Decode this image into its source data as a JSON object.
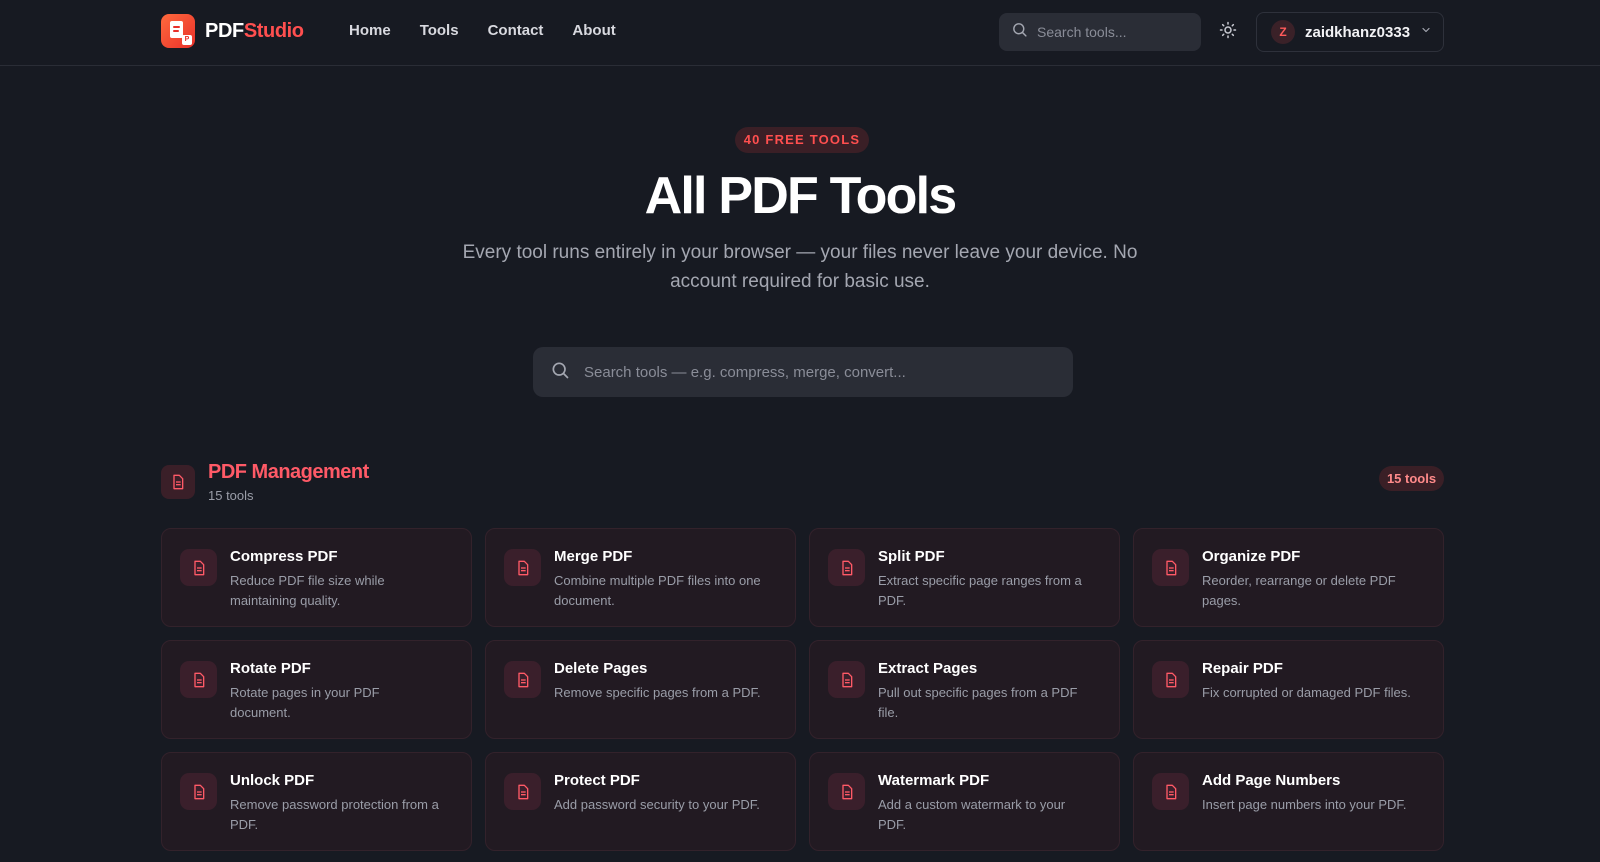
{
  "brand": {
    "name_part1": "PDF",
    "name_part2": "Studio",
    "accent": "#ff4f4f"
  },
  "nav": {
    "items": [
      {
        "label": "Home"
      },
      {
        "label": "Tools"
      },
      {
        "label": "Contact"
      },
      {
        "label": "About"
      }
    ]
  },
  "header_search": {
    "placeholder": "Search tools..."
  },
  "theme_toggle": {
    "icon": "sun-icon"
  },
  "user": {
    "avatar_letter": "Z",
    "name": "zaidkhanz0333",
    "icon": "chevron-down-icon"
  },
  "hero": {
    "badge": "40 FREE TOOLS",
    "title": "All PDF Tools",
    "subtitle": "Every tool runs entirely in your browser — your files never leave your device. No account required for basic use.",
    "search_placeholder": "Search tools — e.g. compress, merge, convert..."
  },
  "section": {
    "title": "PDF Management",
    "count": "15 tools",
    "pill": "15 tools",
    "icon": "document-icon",
    "tools": [
      {
        "title": "Compress PDF",
        "desc": "Reduce PDF file size while maintaining quality."
      },
      {
        "title": "Merge PDF",
        "desc": "Combine multiple PDF files into one document."
      },
      {
        "title": "Split PDF",
        "desc": "Extract specific page ranges from a PDF."
      },
      {
        "title": "Organize PDF",
        "desc": "Reorder, rearrange or delete PDF pages."
      },
      {
        "title": "Rotate PDF",
        "desc": "Rotate pages in your PDF document."
      },
      {
        "title": "Delete Pages",
        "desc": "Remove specific pages from a PDF."
      },
      {
        "title": "Extract Pages",
        "desc": "Pull out specific pages from a PDF file."
      },
      {
        "title": "Repair PDF",
        "desc": "Fix corrupted or damaged PDF files."
      },
      {
        "title": "Unlock PDF",
        "desc": "Remove password protection from a PDF."
      },
      {
        "title": "Protect PDF",
        "desc": "Add password security to your PDF."
      },
      {
        "title": "Watermark PDF",
        "desc": "Add a custom watermark to your PDF."
      },
      {
        "title": "Add Page Numbers",
        "desc": "Insert page numbers into your PDF."
      }
    ]
  }
}
